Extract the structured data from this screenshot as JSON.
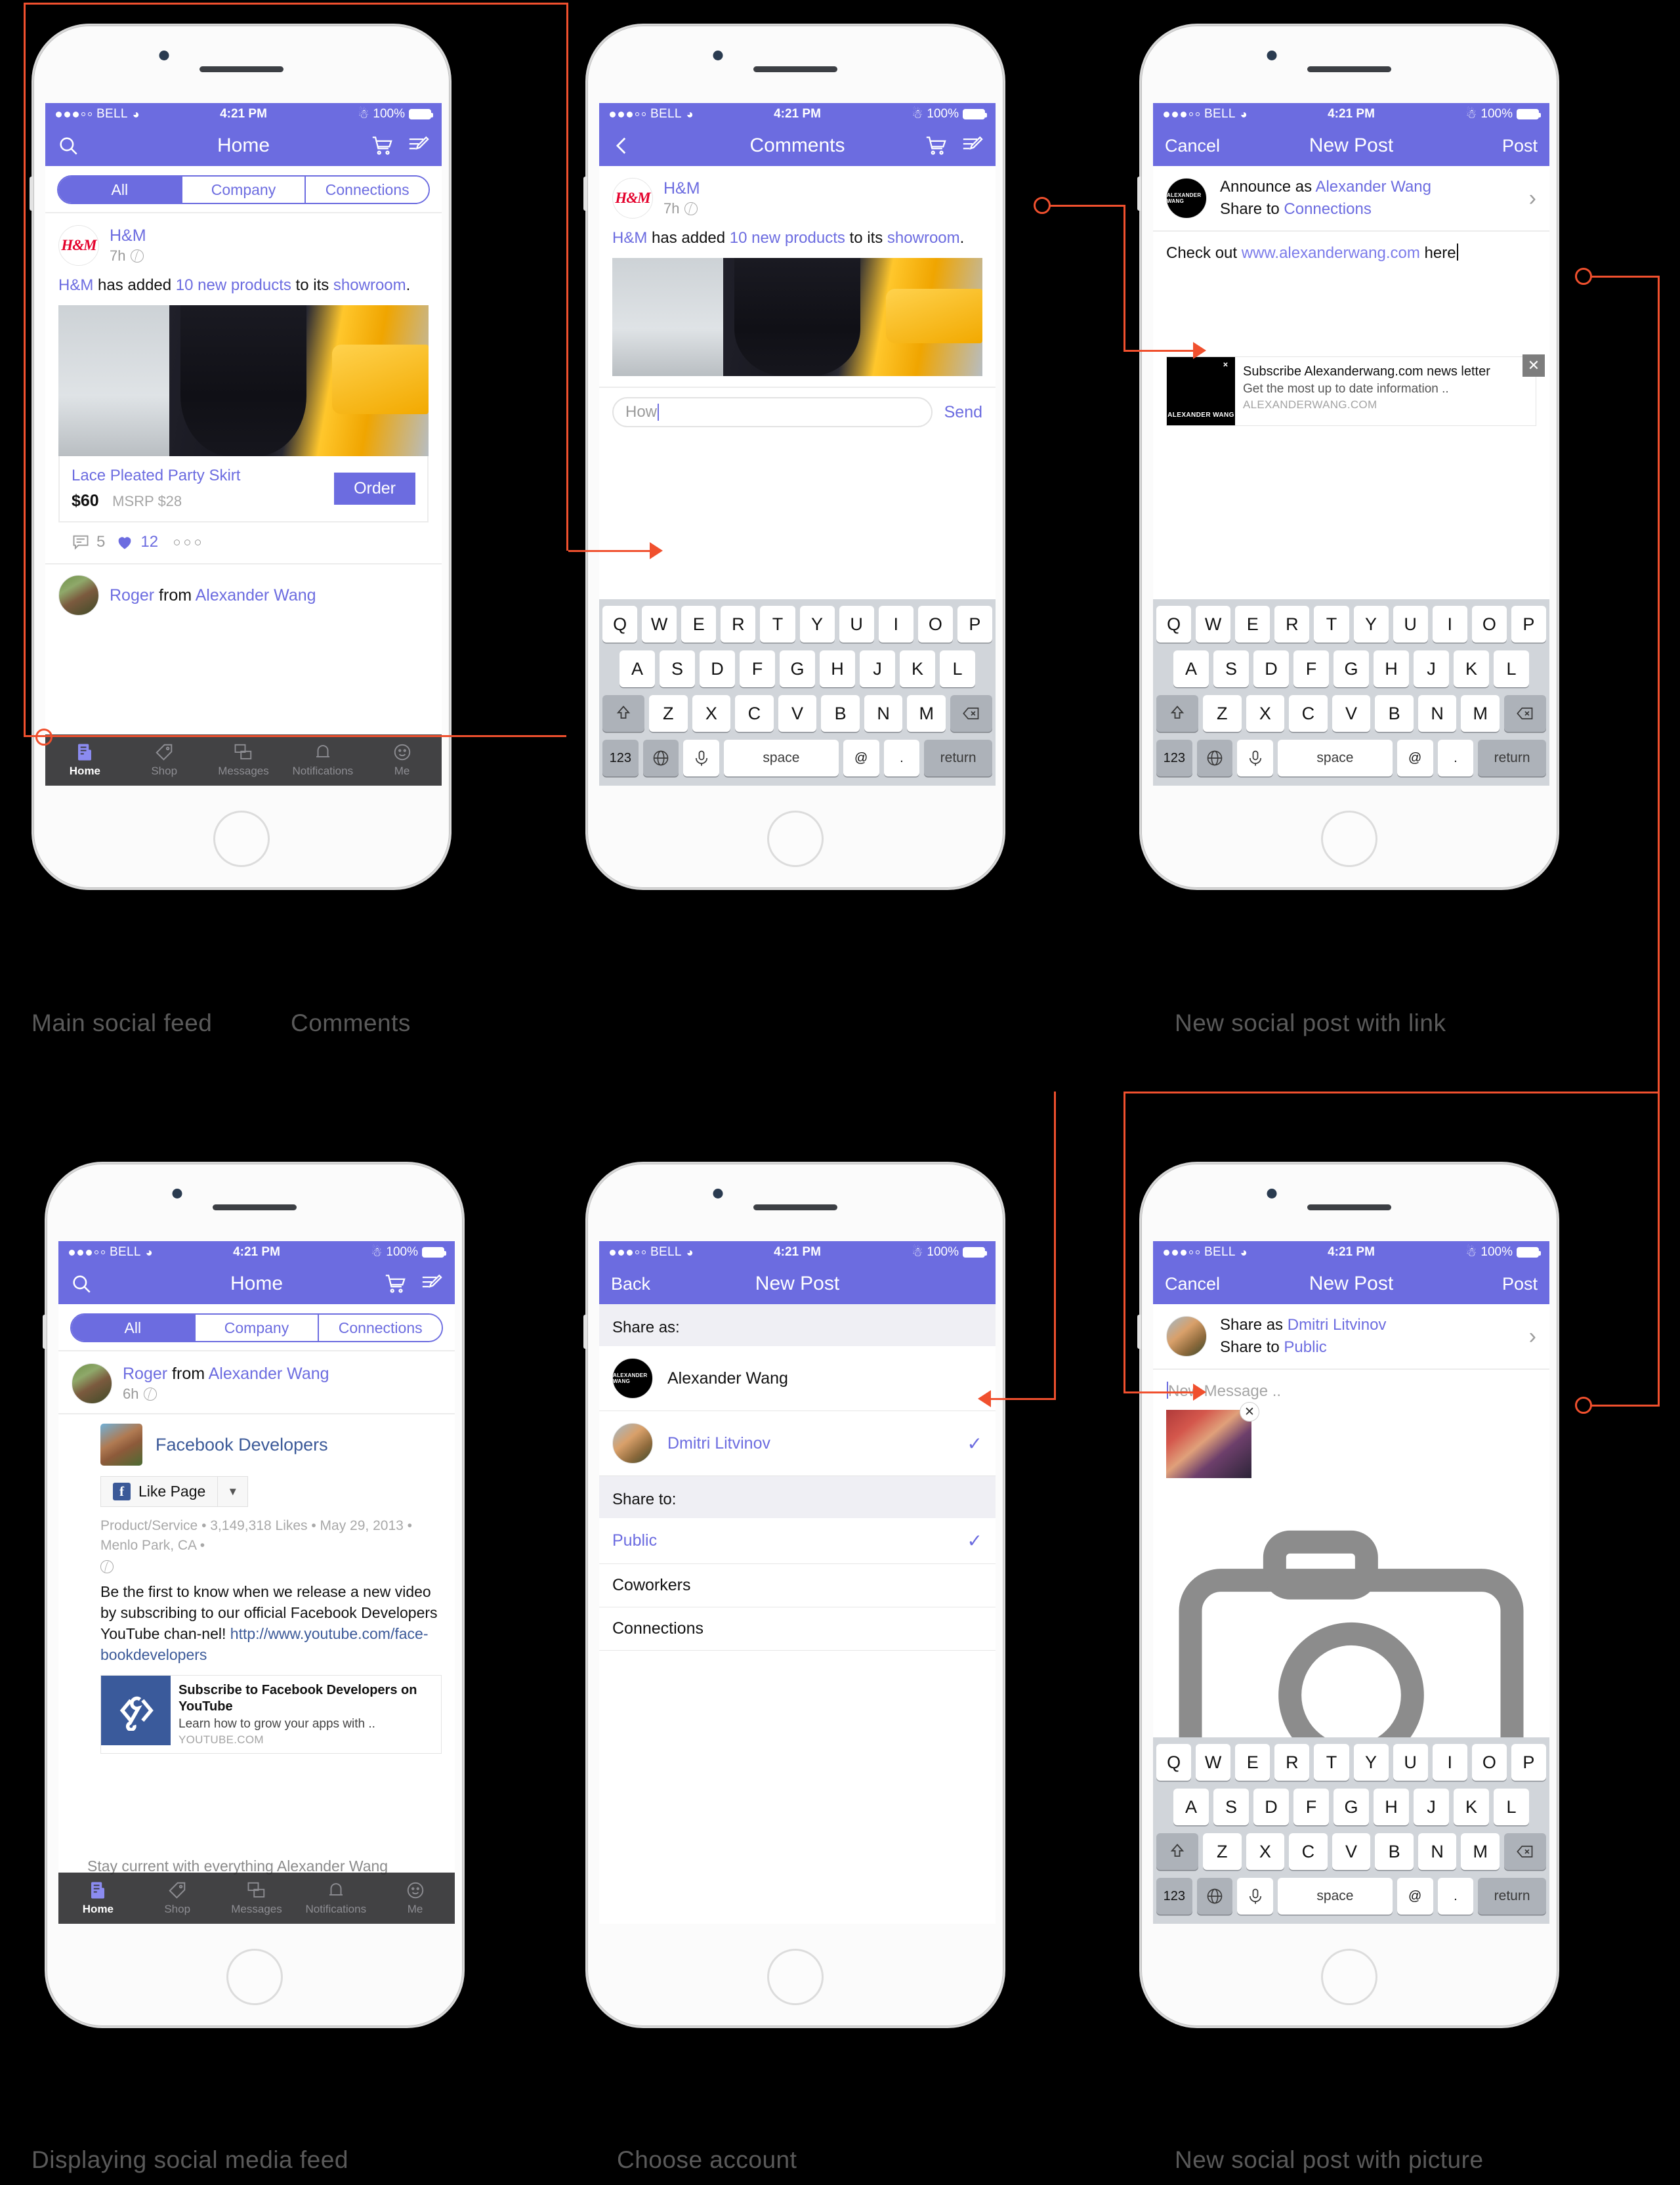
{
  "theme": {
    "accent": "#6c6ce0",
    "flow": "#f0502e",
    "tabbar": "#282a2a"
  },
  "captions": [
    "Main social feed",
    "Comments",
    "New social post with link",
    "Displaying social media feed",
    "Choose account",
    "New social post with picture"
  ],
  "status_bar": {
    "carrier": "BELL",
    "time": "4:21 PM",
    "battery": "100%",
    "signal_filled": 3,
    "signal_empty": 2
  },
  "screen1": {
    "nav": {
      "title": "Home",
      "search_icon": "search-icon",
      "cart_icon": "cart-icon",
      "compose_icon": "compose-icon"
    },
    "segments": [
      {
        "label": "All",
        "active": true
      },
      {
        "label": "Company",
        "active": false
      },
      {
        "label": "Connections",
        "active": false
      }
    ],
    "post": {
      "author": "H&M",
      "avatar_text": "H&M",
      "time": "7h",
      "text_pre": "H&M",
      "text_mid": " has added ",
      "text_link": "10 new products",
      "text_post": " to its ",
      "text_link2": "showroom",
      "text_end": ".",
      "product": {
        "name": "Lace Pleated Party Skirt",
        "price": "$60",
        "msrp": "MSRP $28",
        "order_label": "Order"
      },
      "comment_count": "5",
      "like_count": "12"
    },
    "next_post_author_a": "Roger",
    "next_post_author_b": "from",
    "next_post_author_c": "Alexander Wang",
    "tabs": [
      {
        "label": "Home",
        "icon": "feed-icon",
        "active": true
      },
      {
        "label": "Shop",
        "icon": "tag-icon",
        "active": false
      },
      {
        "label": "Messages",
        "icon": "chat-icon",
        "active": false
      },
      {
        "label": "Notifications",
        "icon": "bell-icon",
        "active": false
      },
      {
        "label": "Me",
        "icon": "face-icon",
        "active": false
      }
    ]
  },
  "screen2": {
    "nav": {
      "back_icon": "chevron-left-icon",
      "title": "Comments",
      "cart_icon": "cart-icon",
      "compose_icon": "compose-icon"
    },
    "post": {
      "author": "H&M",
      "avatar_text": "H&M",
      "time": "7h",
      "text_pre": "H&M",
      "text_mid": " has added ",
      "text_link": "10 new products",
      "text_post": " to its ",
      "text_link2": "showroom",
      "text_end": "."
    },
    "input": {
      "value": "How",
      "placeholder": "How"
    },
    "send_label": "Send"
  },
  "screen3": {
    "nav": {
      "cancel": "Cancel",
      "title": "New Post",
      "post": "Post"
    },
    "share": {
      "announce_pre": "Announce as ",
      "announce_name": "Alexander Wang",
      "share_pre": "Share to ",
      "share_target": "Connections",
      "avatar_text": "ALEXANDER WANG"
    },
    "body": {
      "pre": "Check out ",
      "link": "www.alexanderwang.com",
      "post": " here"
    },
    "link_card": {
      "thumb_text": "ALEXANDER WANG",
      "title": "Subscribe Alexanderwang.com news letter",
      "desc": "Get the most up to date information ..",
      "domain": "ALEXANDERWANG.COM",
      "close": "✕"
    }
  },
  "screen4": {
    "nav": {
      "title": "Home",
      "search_icon": "search-icon",
      "cart_icon": "cart-icon",
      "compose_icon": "compose-icon"
    },
    "segments": [
      {
        "label": "All",
        "active": true
      },
      {
        "label": "Company",
        "active": false
      },
      {
        "label": "Connections",
        "active": false
      }
    ],
    "post": {
      "author_a": "Roger",
      "author_b": "from",
      "author_c": "Alexander Wang",
      "time": "6h",
      "page_name": "Facebook Developers",
      "like_page_label": "Like Page",
      "meta": "Product/Service • 3,149,318 Likes • May 29, 2013 • Menlo Park, CA •",
      "body_pre": "Be the first to know when we release a new video by subscribing to our official Facebook Developers YouTube chan-nel! ",
      "body_link": "http://www.youtube.com/face-bookdevelopers",
      "link_card": {
        "title": "Subscribe to Facebook Developers on YouTube",
        "desc": "Learn how to grow your apps with ..",
        "domain": "YOUTUBE.COM"
      },
      "ghost_line": "Stay current with everything Alexander Wang"
    },
    "tabs": [
      {
        "label": "Home",
        "icon": "feed-icon",
        "active": true
      },
      {
        "label": "Shop",
        "icon": "tag-icon",
        "active": false
      },
      {
        "label": "Messages",
        "icon": "chat-icon",
        "active": false
      },
      {
        "label": "Notifications",
        "icon": "bell-icon",
        "active": false
      },
      {
        "label": "Me",
        "icon": "face-icon",
        "active": false
      }
    ]
  },
  "screen5": {
    "nav": {
      "back": "Back",
      "title": "New Post"
    },
    "share_as_header": "Share as:",
    "accounts": [
      {
        "name": "Alexander Wang",
        "selected": false,
        "avatar": "aw"
      },
      {
        "name": "Dmitri Litvinov",
        "selected": true,
        "avatar": "photo2"
      }
    ],
    "share_to_header": "Share to:",
    "audiences": [
      {
        "name": "Public",
        "selected": true
      },
      {
        "name": "Coworkers",
        "selected": false
      },
      {
        "name": "Connections",
        "selected": false
      }
    ],
    "check_glyph": "✓"
  },
  "screen6": {
    "nav": {
      "cancel": "Cancel",
      "title": "New Post",
      "post": "Post"
    },
    "share": {
      "share_as_pre": "Share as ",
      "share_as_name": "Dmitri Litvinov",
      "share_to_pre": "Share to ",
      "share_to_target": "Public"
    },
    "input": {
      "placeholder": "New Message .."
    },
    "attachment_close": "✕",
    "camera_icon": "camera-icon"
  },
  "keyboard": {
    "row1": [
      "Q",
      "W",
      "E",
      "R",
      "T",
      "Y",
      "U",
      "I",
      "O",
      "P"
    ],
    "row2": [
      "A",
      "S",
      "D",
      "F",
      "G",
      "H",
      "J",
      "K",
      "L"
    ],
    "row3": [
      "Z",
      "X",
      "C",
      "V",
      "B",
      "N",
      "M"
    ],
    "shift_icon": "shift-icon",
    "backspace_icon": "backspace-icon",
    "numeric_label": "123",
    "globe_icon": "globe-icon",
    "mic_icon": "mic-icon",
    "space_label": "space",
    "at_label": "@",
    "period_label": ".",
    "return_label": "return"
  }
}
